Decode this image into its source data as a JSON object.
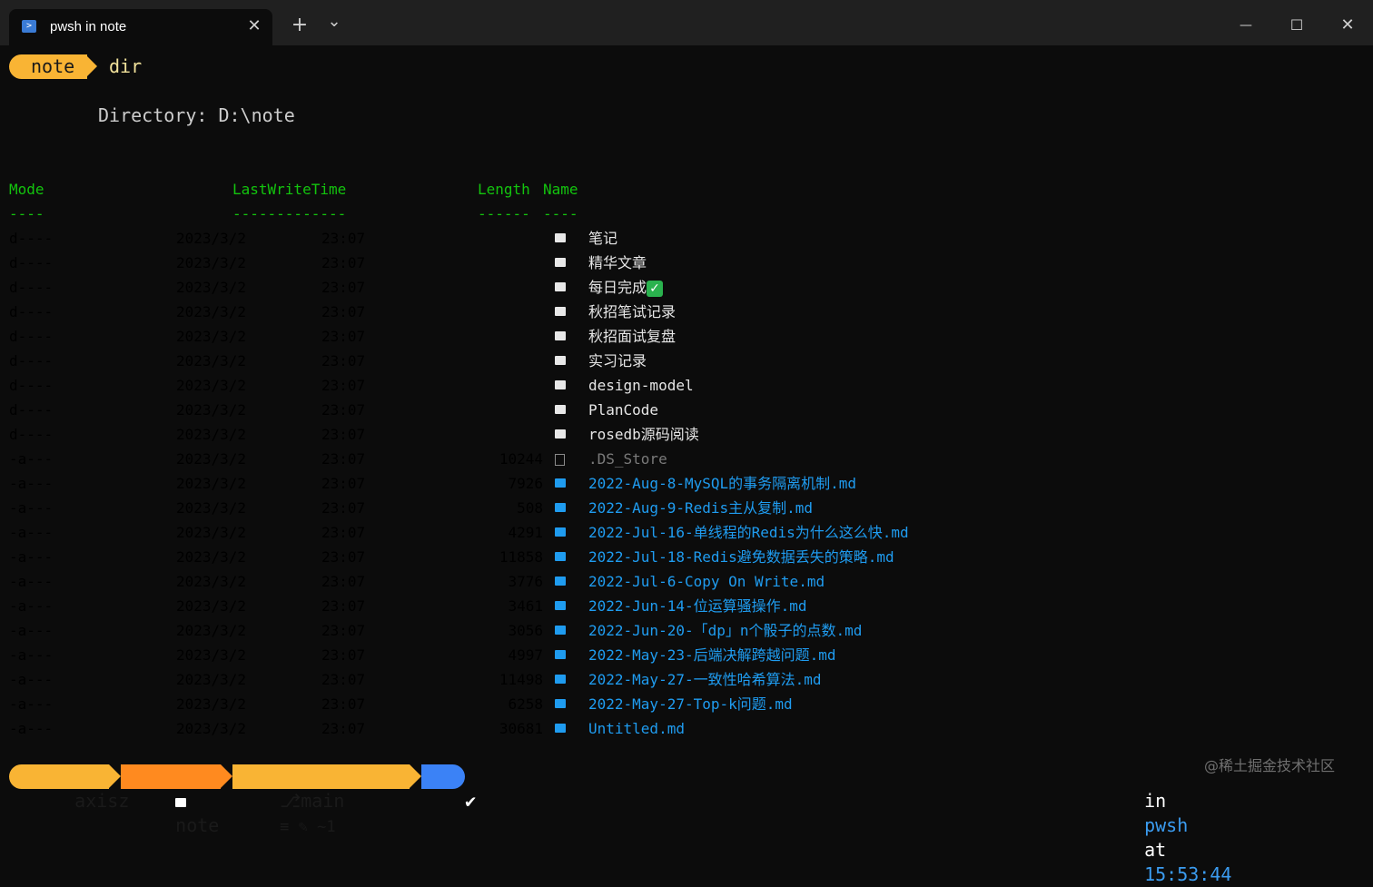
{
  "window": {
    "tab_title": "pwsh in note",
    "tab_close": "✕",
    "new_tab": "+",
    "dropdown": "⌄",
    "minimize": "—",
    "maximize": "☐",
    "close": "✕"
  },
  "prompt": {
    "dir_label": "note",
    "command": "dir"
  },
  "listing": {
    "directory_line": "Directory: D:\\note",
    "headers": {
      "mode": "Mode",
      "lastwritetime": "LastWriteTime",
      "length": "Length",
      "name": "Name"
    },
    "underlines": {
      "mode": "----",
      "lastwritetime": "-------------",
      "length": "------",
      "name": "----"
    },
    "rows": [
      {
        "mode": "d----",
        "date": "2023/3/2",
        "time": "23:07",
        "length": "",
        "name": "笔记",
        "kind": "dir"
      },
      {
        "mode": "d----",
        "date": "2023/3/2",
        "time": "23:07",
        "length": "",
        "name": "精华文章",
        "kind": "dir"
      },
      {
        "mode": "d----",
        "date": "2023/3/2",
        "time": "23:07",
        "length": "",
        "name": "每日完成",
        "kind": "dir",
        "badge": "✓"
      },
      {
        "mode": "d----",
        "date": "2023/3/2",
        "time": "23:07",
        "length": "",
        "name": "秋招笔试记录",
        "kind": "dir"
      },
      {
        "mode": "d----",
        "date": "2023/3/2",
        "time": "23:07",
        "length": "",
        "name": "秋招面试复盘",
        "kind": "dir"
      },
      {
        "mode": "d----",
        "date": "2023/3/2",
        "time": "23:07",
        "length": "",
        "name": "实习记录",
        "kind": "dir"
      },
      {
        "mode": "d----",
        "date": "2023/3/2",
        "time": "23:07",
        "length": "",
        "name": "design-model",
        "kind": "dir"
      },
      {
        "mode": "d----",
        "date": "2023/3/2",
        "time": "23:07",
        "length": "",
        "name": "PlanCode",
        "kind": "dir"
      },
      {
        "mode": "d----",
        "date": "2023/3/2",
        "time": "23:07",
        "length": "",
        "name": "rosedb源码阅读",
        "kind": "dir"
      },
      {
        "mode": "-a---",
        "date": "2023/3/2",
        "time": "23:07",
        "length": "10244",
        "name": ".DS_Store",
        "kind": "hidden"
      },
      {
        "mode": "-a---",
        "date": "2023/3/2",
        "time": "23:07",
        "length": "7926",
        "name": "2022-Aug-8-MySQL的事务隔离机制.md",
        "kind": "md"
      },
      {
        "mode": "-a---",
        "date": "2023/3/2",
        "time": "23:07",
        "length": "508",
        "name": "2022-Aug-9-Redis主从复制.md",
        "kind": "md"
      },
      {
        "mode": "-a---",
        "date": "2023/3/2",
        "time": "23:07",
        "length": "4291",
        "name": "2022-Jul-16-单线程的Redis为什么这么快.md",
        "kind": "md"
      },
      {
        "mode": "-a---",
        "date": "2023/3/2",
        "time": "23:07",
        "length": "11858",
        "name": "2022-Jul-18-Redis避免数据丢失的策略.md",
        "kind": "md"
      },
      {
        "mode": "-a---",
        "date": "2023/3/2",
        "time": "23:07",
        "length": "3776",
        "name": "2022-Jul-6-Copy On Write.md",
        "kind": "md"
      },
      {
        "mode": "-a---",
        "date": "2023/3/2",
        "time": "23:07",
        "length": "3461",
        "name": "2022-Jun-14-位运算骚操作.md",
        "kind": "md"
      },
      {
        "mode": "-a---",
        "date": "2023/3/2",
        "time": "23:07",
        "length": "3056",
        "name": "2022-Jun-20-「dp」n个骰子的点数.md",
        "kind": "md"
      },
      {
        "mode": "-a---",
        "date": "2023/3/2",
        "time": "23:07",
        "length": "4997",
        "name": "2022-May-23-后端决解跨越问题.md",
        "kind": "md"
      },
      {
        "mode": "-a---",
        "date": "2023/3/2",
        "time": "23:07",
        "length": "11498",
        "name": "2022-May-27-一致性哈希算法.md",
        "kind": "md"
      },
      {
        "mode": "-a---",
        "date": "2023/3/2",
        "time": "23:07",
        "length": "6258",
        "name": "2022-May-27-Top-k问题.md",
        "kind": "md"
      },
      {
        "mode": "-a---",
        "date": "2023/3/2",
        "time": "23:07",
        "length": "30681",
        "name": "Untitled.md",
        "kind": "md"
      }
    ]
  },
  "status_bar": {
    "user": "axisz",
    "folder": "note",
    "branch": "main",
    "branch_status": "≡ ✎ ~1",
    "ok": "✔",
    "right_prefix": "in",
    "shell": "pwsh",
    "at": "at",
    "clock": "15:53:44"
  },
  "watermark": "@稀土掘金技术社区",
  "colors": {
    "prompt_yellow": "#f9b434",
    "prompt_orange": "#ff8a1f",
    "ok_blue": "#3b82f6",
    "header_green": "#13c40e",
    "file_blue": "#1f9cf0"
  }
}
